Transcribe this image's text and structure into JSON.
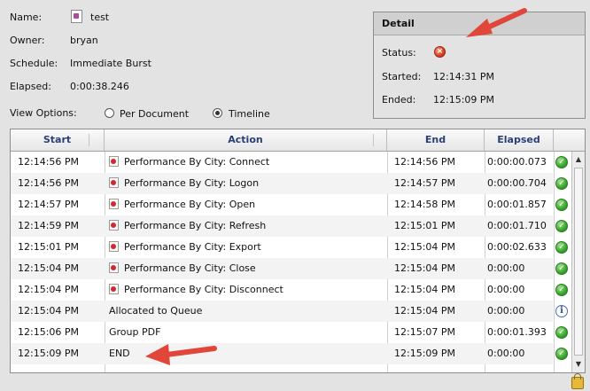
{
  "info": {
    "name_label": "Name:",
    "name_value": "test",
    "owner_label": "Owner:",
    "owner_value": "bryan",
    "schedule_label": "Schedule:",
    "schedule_value": "Immediate Burst",
    "elapsed_label": "Elapsed:",
    "elapsed_value": "0:00:38.246"
  },
  "view_options": {
    "label": "View Options:",
    "per_document": "Per Document",
    "timeline": "Timeline",
    "selected": "timeline"
  },
  "detail": {
    "title": "Detail",
    "status_label": "Status:",
    "status_icon": "error-icon",
    "started_label": "Started:",
    "started_value": "12:14:31 PM",
    "ended_label": "Ended:",
    "ended_value": "12:15:09 PM"
  },
  "grid": {
    "headers": {
      "start": "Start",
      "action": "Action",
      "end": "End",
      "elapsed": "Elapsed"
    },
    "rows": [
      {
        "start": "12:14:56 PM",
        "action": "Performance By City: Connect",
        "icon": true,
        "end": "12:14:56 PM",
        "elapsed": "0:00:00.073",
        "status": "ok"
      },
      {
        "start": "12:14:56 PM",
        "action": "Performance By City: Logon",
        "icon": true,
        "end": "12:14:57 PM",
        "elapsed": "0:00:00.704",
        "status": "ok"
      },
      {
        "start": "12:14:57 PM",
        "action": "Performance By City: Open",
        "icon": true,
        "end": "12:14:58 PM",
        "elapsed": "0:00:01.857",
        "status": "ok"
      },
      {
        "start": "12:14:59 PM",
        "action": "Performance By City: Refresh",
        "icon": true,
        "end": "12:15:01 PM",
        "elapsed": "0:00:01.710",
        "status": "ok"
      },
      {
        "start": "12:15:01 PM",
        "action": "Performance By City: Export",
        "icon": true,
        "end": "12:15:04 PM",
        "elapsed": "0:00:02.633",
        "status": "ok"
      },
      {
        "start": "12:15:04 PM",
        "action": "Performance By City: Close",
        "icon": true,
        "end": "12:15:04 PM",
        "elapsed": "0:00:00",
        "status": "ok"
      },
      {
        "start": "12:15:04 PM",
        "action": "Performance By City: Disconnect",
        "icon": true,
        "end": "12:15:04 PM",
        "elapsed": "0:00:00",
        "status": "ok"
      },
      {
        "start": "12:15:04 PM",
        "action": "Allocated to Queue",
        "icon": false,
        "end": "12:15:04 PM",
        "elapsed": "0:00:00",
        "status": "info"
      },
      {
        "start": "12:15:06 PM",
        "action": "Group PDF",
        "icon": false,
        "end": "12:15:07 PM",
        "elapsed": "0:00:01.393",
        "status": "ok"
      },
      {
        "start": "12:15:09 PM",
        "action": "END",
        "icon": false,
        "end": "12:15:09 PM",
        "elapsed": "0:00:00",
        "status": "ok"
      }
    ]
  },
  "colors": {
    "accent_header": "#2a3f78",
    "annotation_arrow": "#e0473a",
    "ok": "#3aa62e",
    "error": "#d8381a"
  }
}
